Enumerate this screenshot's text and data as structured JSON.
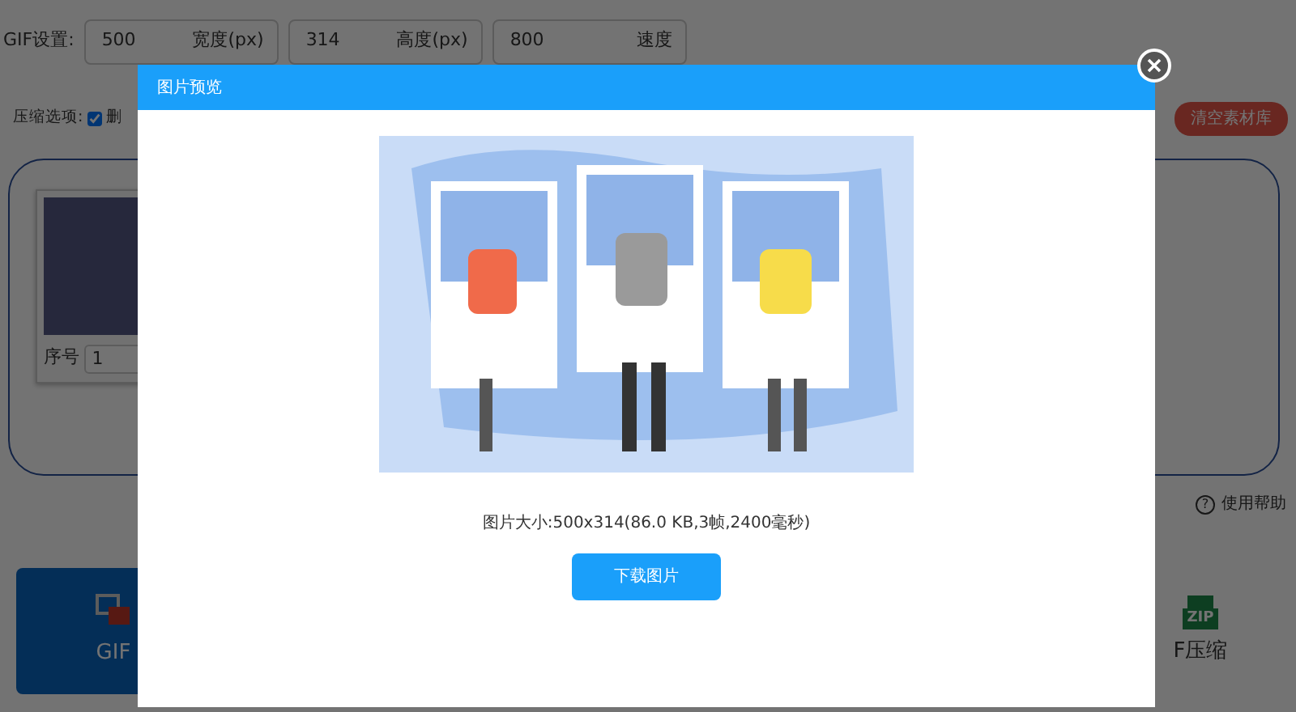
{
  "gif_settings": {
    "label": "GIF设置:",
    "fields": [
      {
        "value": "500",
        "unit": "宽度(px)"
      },
      {
        "value": "314",
        "unit": "高度(px)"
      },
      {
        "value": "800",
        "unit": "速度"
      }
    ]
  },
  "compress_options": {
    "label": "压缩选项:",
    "options": [
      {
        "label": "删",
        "checked": true
      }
    ]
  },
  "clear_button": "清空素材库",
  "frames": [
    {
      "index_label": "序号",
      "index": "1"
    }
  ],
  "help_icon": "?",
  "help_link": "使用帮助",
  "tiles": [
    {
      "label": "GIF",
      "selected": true
    },
    {
      "label": "F压缩",
      "selected": false,
      "badge": "ZIP"
    }
  ],
  "modal": {
    "title": "图片预览",
    "info": "图片大小:500x314(86.0 KB,3帧,2400毫秒)",
    "download_button": "下载图片"
  }
}
